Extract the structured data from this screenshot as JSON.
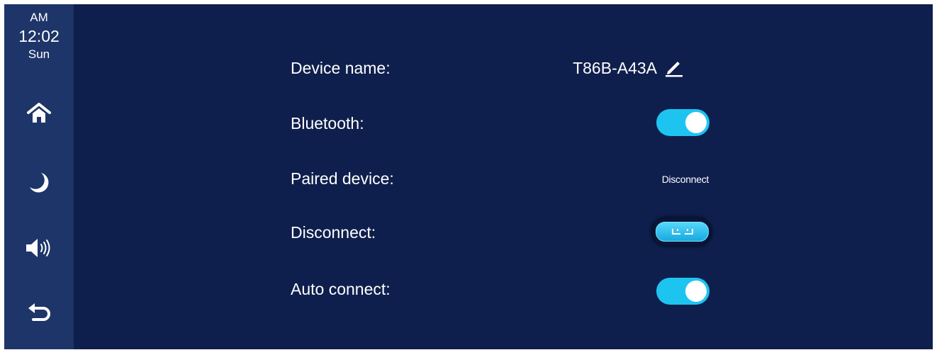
{
  "clock": {
    "ampm": "AM",
    "time": "12:02",
    "day": "Sun"
  },
  "sidebar": {
    "buttons": [
      {
        "name": "home",
        "icon": "home-icon"
      },
      {
        "name": "night-mode",
        "icon": "moon-icon"
      },
      {
        "name": "volume",
        "icon": "speaker-icon"
      },
      {
        "name": "back",
        "icon": "back-arrow-icon"
      }
    ]
  },
  "settings": {
    "device_name": {
      "label": "Device name:",
      "value": "T86B-A43A",
      "edit_icon": "pencil-icon"
    },
    "bluetooth": {
      "label": "Bluetooth:",
      "enabled": true
    },
    "paired_device": {
      "label": "Paired device:",
      "value": "Disconnect"
    },
    "disconnect": {
      "label": "Disconnect:",
      "button_icon": "disconnect-icon"
    },
    "auto_connect": {
      "label": "Auto connect:",
      "enabled": true
    }
  },
  "colors": {
    "background": "#0f1f4d",
    "sidebar": "#1e3569",
    "accent": "#1ec4f0",
    "text": "#ffffff"
  }
}
